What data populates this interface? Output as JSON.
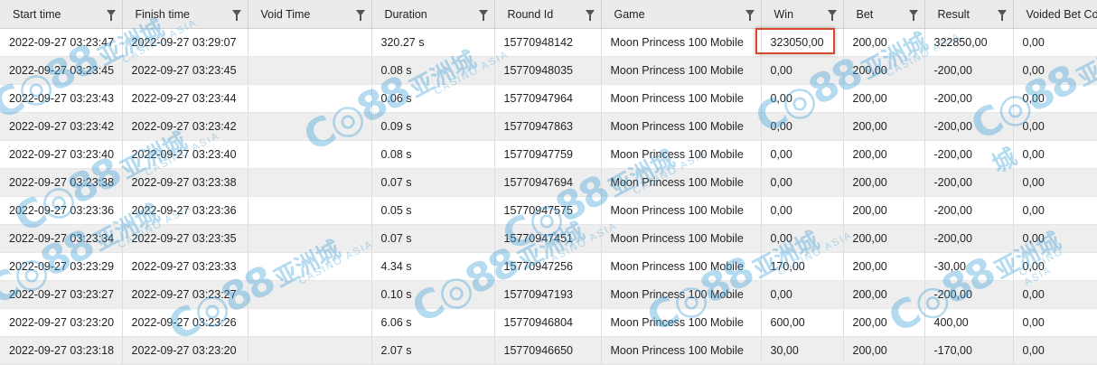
{
  "columns": [
    {
      "key": "start",
      "label": "Start time"
    },
    {
      "key": "finish",
      "label": "Finish time"
    },
    {
      "key": "void",
      "label": "Void Time"
    },
    {
      "key": "duration",
      "label": "Duration"
    },
    {
      "key": "round",
      "label": "Round Id"
    },
    {
      "key": "game",
      "label": "Game"
    },
    {
      "key": "win",
      "label": "Win"
    },
    {
      "key": "bet",
      "label": "Bet"
    },
    {
      "key": "result",
      "label": "Result"
    },
    {
      "key": "voided",
      "label": "Voided Bet Cost"
    }
  ],
  "rows": [
    [
      "2022-09-27 03:23:47",
      "2022-09-27 03:29:07",
      "",
      "320.27 s",
      "15770948142",
      "Moon Princess 100 Mobile",
      "323050,00",
      "200,00",
      "322850,00",
      "0,00"
    ],
    [
      "2022-09-27 03:23:45",
      "2022-09-27 03:23:45",
      "",
      "0.08 s",
      "15770948035",
      "Moon Princess 100 Mobile",
      "0,00",
      "200,00",
      "-200,00",
      "0,00"
    ],
    [
      "2022-09-27 03:23:43",
      "2022-09-27 03:23:44",
      "",
      "0.06 s",
      "15770947964",
      "Moon Princess 100 Mobile",
      "0,00",
      "200,00",
      "-200,00",
      "0,00"
    ],
    [
      "2022-09-27 03:23:42",
      "2022-09-27 03:23:42",
      "",
      "0.09 s",
      "15770947863",
      "Moon Princess 100 Mobile",
      "0,00",
      "200,00",
      "-200,00",
      "0,00"
    ],
    [
      "2022-09-27 03:23:40",
      "2022-09-27 03:23:40",
      "",
      "0.08 s",
      "15770947759",
      "Moon Princess 100 Mobile",
      "0,00",
      "200,00",
      "-200,00",
      "0,00"
    ],
    [
      "2022-09-27 03:23:38",
      "2022-09-27 03:23:38",
      "",
      "0.07 s",
      "15770947694",
      "Moon Princess 100 Mobile",
      "0,00",
      "200,00",
      "-200,00",
      "0,00"
    ],
    [
      "2022-09-27 03:23:36",
      "2022-09-27 03:23:36",
      "",
      "0.05 s",
      "15770947575",
      "Moon Princess 100 Mobile",
      "0,00",
      "200,00",
      "-200,00",
      "0,00"
    ],
    [
      "2022-09-27 03:23:34",
      "2022-09-27 03:23:35",
      "",
      "0.07 s",
      "15770947451",
      "Moon Princess 100 Mobile",
      "0,00",
      "200,00",
      "-200,00",
      "0,00"
    ],
    [
      "2022-09-27 03:23:29",
      "2022-09-27 03:23:33",
      "",
      "4.34 s",
      "15770947256",
      "Moon Princess 100 Mobile",
      "170,00",
      "200,00",
      "-30,00",
      "0,00"
    ],
    [
      "2022-09-27 03:23:27",
      "2022-09-27 03:23:27",
      "",
      "0.10 s",
      "15770947193",
      "Moon Princess 100 Mobile",
      "0,00",
      "200,00",
      "-200,00",
      "0,00"
    ],
    [
      "2022-09-27 03:23:20",
      "2022-09-27 03:23:26",
      "",
      "6.06 s",
      "15770946804",
      "Moon Princess 100 Mobile",
      "600,00",
      "200,00",
      "400,00",
      "0,00"
    ],
    [
      "2022-09-27 03:23:18",
      "2022-09-27 03:23:20",
      "",
      "2.07 s",
      "15770946650",
      "Moon Princess 100 Mobile",
      "30,00",
      "200,00",
      "-170,00",
      "0,00"
    ]
  ],
  "watermark": {
    "logo": "C◎88",
    "cn": "亚洲城",
    "sub": "CASINO ASIA"
  },
  "colors": {
    "highlight": "#d9472f",
    "watermark": "#3fa1d8"
  }
}
